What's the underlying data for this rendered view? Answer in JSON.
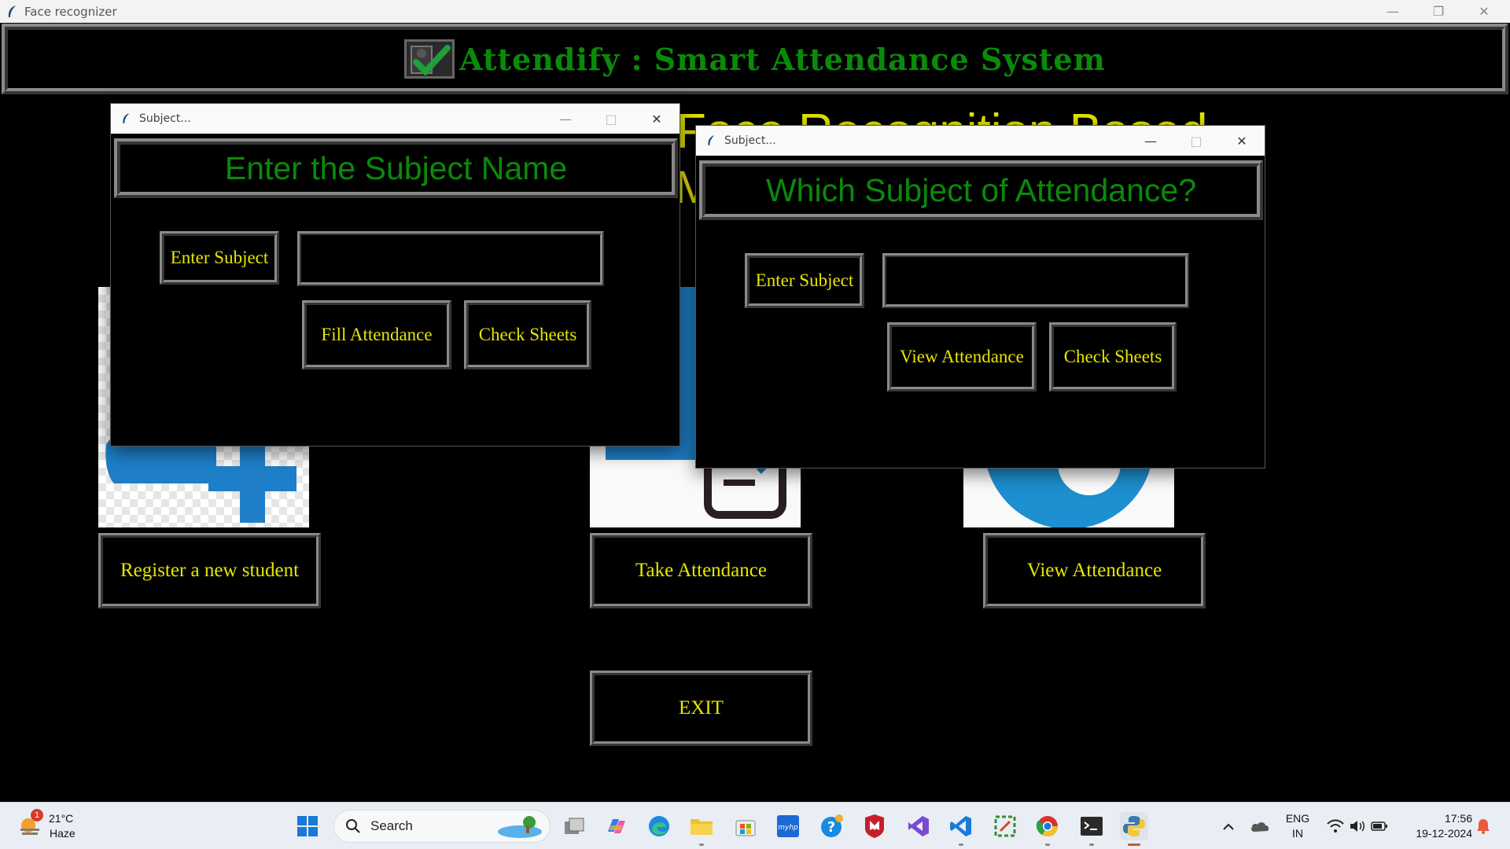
{
  "window": {
    "title": "Face recognizer",
    "minimize_icon": "minimize-icon",
    "restore_icon": "restore-icon",
    "close_icon": "close-icon"
  },
  "header": {
    "title": "Attendify : Smart Attendance System",
    "logo_icon": "attendance-check-icon"
  },
  "background_subtitle": {
    "line1": "Face Recognition Based",
    "line2": "M"
  },
  "main_buttons": {
    "register": "Register a new student",
    "take_attendance": "Take Attendance",
    "view_attendance": "View Attendance",
    "exit": "EXIT"
  },
  "dialog_fill": {
    "title": "Subject...",
    "heading": "Enter the Subject Name",
    "subject_label": "Enter Subject",
    "subject_value": "",
    "fill_button": "Fill Attendance",
    "check_button": "Check Sheets"
  },
  "dialog_view": {
    "title": "Subject...",
    "heading": "Which Subject of Attendance?",
    "subject_label": "Enter Subject",
    "subject_value": "",
    "view_button": "View Attendance",
    "check_button": "Check Sheets"
  },
  "taskbar": {
    "weather_temp": "21°C",
    "weather_desc": "Haze",
    "weather_badge": "1",
    "search_label": "Search",
    "language": "ENG",
    "region": "IN",
    "time": "17:56",
    "date": "19-12-2024"
  },
  "colors": {
    "header_green": "#0a8a0a",
    "button_text_yellow": "#e6e600",
    "background": "#000000",
    "border_gray": "#8a8a8a"
  }
}
